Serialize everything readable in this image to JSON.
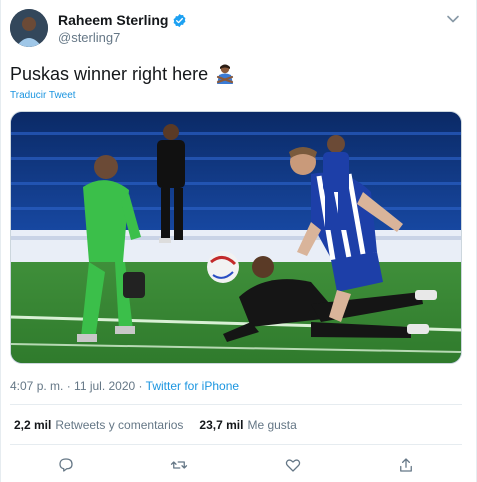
{
  "author": {
    "display_name": "Raheem Sterling",
    "handle": "@sterling7",
    "verified": true
  },
  "tweet": {
    "text": "Puskas winner right here",
    "emoji": "person-gesturing-no-emoji",
    "translate_label": "Traducir Tweet",
    "image_alt": "Sterling on the ground after a shot, goalkeeper and Brighton defender nearby"
  },
  "meta": {
    "time": "4:07 p. m.",
    "separator": " · ",
    "date": "11 jul. 2020",
    "source_label": "Twitter for iPhone"
  },
  "stats": {
    "retweets_count": "2,2 mil",
    "retweets_label": "Retweets y comentarios",
    "likes_count": "23,7 mil",
    "likes_label": "Me gusta"
  },
  "colors": {
    "accent": "#1b95e0",
    "muted": "#657786",
    "text": "#14171a"
  },
  "icons": [
    "verified-badge-icon",
    "chevron-down-icon",
    "reply-icon",
    "retweet-icon",
    "like-icon",
    "share-icon"
  ]
}
